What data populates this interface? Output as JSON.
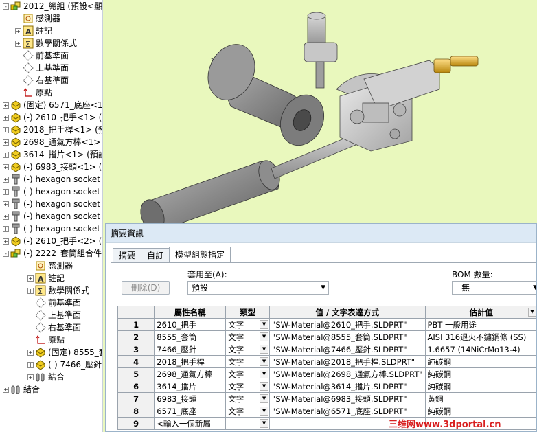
{
  "tree": {
    "items": [
      {
        "label": "2012_總組 (預設<顯示:",
        "icon": "assembly-icon",
        "depth": 0,
        "expander": "-"
      },
      {
        "label": "感測器",
        "icon": "sensor-icon",
        "depth": 1,
        "expander": ""
      },
      {
        "label": "註記",
        "icon": "annotation-icon",
        "depth": 1,
        "expander": "+"
      },
      {
        "label": "數學關係式",
        "icon": "equation-icon",
        "depth": 1,
        "expander": "+"
      },
      {
        "label": "前基準面",
        "icon": "plane-icon",
        "depth": 1,
        "expander": ""
      },
      {
        "label": "上基準面",
        "icon": "plane-icon",
        "depth": 1,
        "expander": ""
      },
      {
        "label": "右基準面",
        "icon": "plane-icon",
        "depth": 1,
        "expander": ""
      },
      {
        "label": "原點",
        "icon": "origin-icon",
        "depth": 1,
        "expander": ""
      },
      {
        "label": "(固定) 6571_底座<1",
        "icon": "part-icon",
        "depth": 0,
        "expander": "+"
      },
      {
        "label": "(-) 2610_把手<1> (",
        "icon": "part-icon",
        "depth": 0,
        "expander": "+"
      },
      {
        "label": "2018_把手桿<1> (預",
        "icon": "part-icon",
        "depth": 0,
        "expander": "+"
      },
      {
        "label": "2698_通氣方棒<1>",
        "icon": "part-icon",
        "depth": 0,
        "expander": "+"
      },
      {
        "label": "3614_擋片<1> (預設",
        "icon": "part-icon",
        "depth": 0,
        "expander": "+"
      },
      {
        "label": "(-) 6983_接頭<1> (",
        "icon": "part-icon",
        "depth": 0,
        "expander": "+"
      },
      {
        "label": "(-) hexagon socket",
        "icon": "toolbox-icon",
        "depth": 0,
        "expander": "+"
      },
      {
        "label": "(-) hexagon socket",
        "icon": "toolbox-icon",
        "depth": 0,
        "expander": "+"
      },
      {
        "label": "(-) hexagon socket",
        "icon": "toolbox-icon",
        "depth": 0,
        "expander": "+"
      },
      {
        "label": "(-) hexagon socket",
        "icon": "toolbox-icon",
        "depth": 0,
        "expander": "+"
      },
      {
        "label": "(-) hexagon socket",
        "icon": "toolbox-icon",
        "depth": 0,
        "expander": "+"
      },
      {
        "label": "(-) 2610_把手<2> (",
        "icon": "part-icon",
        "depth": 0,
        "expander": "+"
      },
      {
        "label": "(-) 2222_套筒組合件",
        "icon": "assembly-icon",
        "depth": 0,
        "expander": "-"
      },
      {
        "label": "感測器",
        "icon": "sensor-icon",
        "depth": 2,
        "expander": ""
      },
      {
        "label": "註記",
        "icon": "annotation-icon",
        "depth": 2,
        "expander": "+"
      },
      {
        "label": "數學關係式",
        "icon": "equation-icon",
        "depth": 2,
        "expander": "+"
      },
      {
        "label": "前基準面",
        "icon": "plane-icon",
        "depth": 2,
        "expander": ""
      },
      {
        "label": "上基準面",
        "icon": "plane-icon",
        "depth": 2,
        "expander": ""
      },
      {
        "label": "右基準面",
        "icon": "plane-icon",
        "depth": 2,
        "expander": ""
      },
      {
        "label": "原點",
        "icon": "origin-icon",
        "depth": 2,
        "expander": ""
      },
      {
        "label": "(固定) 8555_套筒",
        "icon": "part-icon",
        "depth": 2,
        "expander": "+"
      },
      {
        "label": "(-) 7466_壓針<1",
        "icon": "part-icon",
        "depth": 2,
        "expander": "+"
      },
      {
        "label": "結合",
        "icon": "mates-icon",
        "depth": 2,
        "expander": "+"
      },
      {
        "label": "結合",
        "icon": "mates-icon",
        "depth": 0,
        "expander": "+"
      }
    ]
  },
  "dialog": {
    "title": "摘要資訊",
    "tabs": [
      "摘要",
      "自訂",
      "模型組態指定"
    ],
    "delete_button": "刪除(D)",
    "apply_to_label": "套用至(A):",
    "apply_to_value": "預設",
    "bom_label": "BOM 數量:",
    "bom_value": "- 無 -",
    "grid": {
      "headers": [
        "屬性名稱",
        "類型",
        "值 / 文字表達方式",
        "估計值"
      ],
      "rows": [
        {
          "n": "1",
          "name": "2610_把手",
          "type": "文字",
          "expr": "\"SW-Material@2610_把手.SLDPRT\"",
          "value": "PBT 一般用途"
        },
        {
          "n": "2",
          "name": "8555_套筒",
          "type": "文字",
          "expr": "\"SW-Material@8555_套筒.SLDPRT\"",
          "value": "AISI 316退火不鏽鋼條 (SS)"
        },
        {
          "n": "3",
          "name": "7466_壓針",
          "type": "文字",
          "expr": "\"SW-Material@7466_壓針.SLDPRT\"",
          "value": "1.6657 (14NiCrMo13-4)"
        },
        {
          "n": "4",
          "name": "2018_把手桿",
          "type": "文字",
          "expr": "\"SW-Material@2018_把手桿.SLDPRT\"",
          "value": "純碳鋼"
        },
        {
          "n": "5",
          "name": "2698_通氣方棒",
          "type": "文字",
          "expr": "\"SW-Material@2698_通氣方棒.SLDPRT\"",
          "value": "純碳鋼"
        },
        {
          "n": "6",
          "name": "3614_擋片",
          "type": "文字",
          "expr": "\"SW-Material@3614_擋片.SLDPRT\"",
          "value": "純碳鋼"
        },
        {
          "n": "7",
          "name": "6983_接頭",
          "type": "文字",
          "expr": "\"SW-Material@6983_接頭.SLDPRT\"",
          "value": "黃銅"
        },
        {
          "n": "8",
          "name": "6571_底座",
          "type": "文字",
          "expr": "\"SW-Material@6571_底座.SLDPRT\"",
          "value": "純碳鋼"
        },
        {
          "n": "9",
          "name": "<輸入一個新屬",
          "type": "",
          "expr": "",
          "value": ""
        }
      ]
    }
  },
  "watermark": "三维网www.3dportal.cn"
}
